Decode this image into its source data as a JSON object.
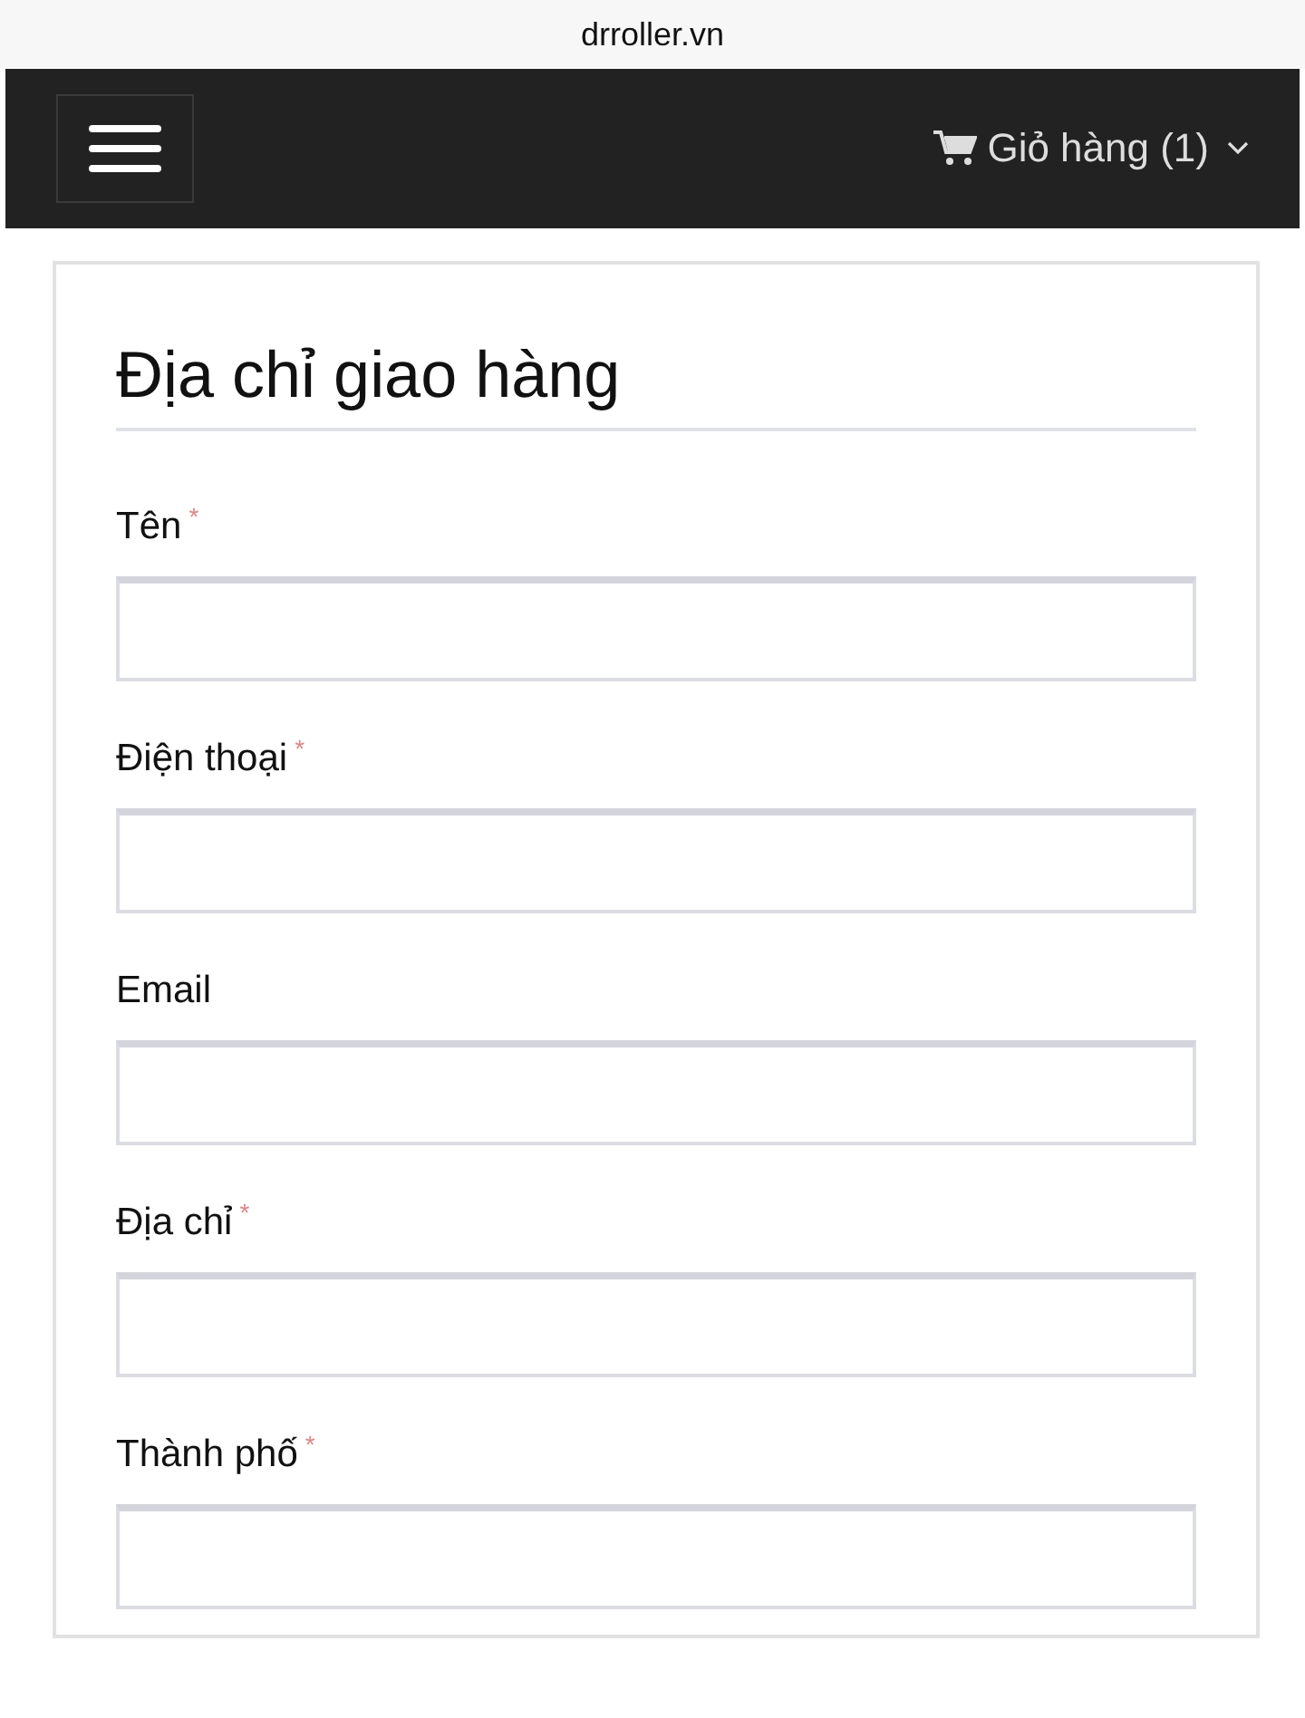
{
  "address_bar": {
    "url": "drroller.vn"
  },
  "navbar": {
    "cart_label": "Giỏ hàng (1)"
  },
  "form": {
    "title": "Địa chỉ giao hàng",
    "fields": [
      {
        "label": "Tên",
        "required_mark": "*"
      },
      {
        "label": "Điện thoại",
        "required_mark": "*"
      },
      {
        "label": "Email"
      },
      {
        "label": "Địa chỉ",
        "required_mark": "*"
      },
      {
        "label": "Thành phố",
        "required_mark": "*"
      }
    ]
  }
}
